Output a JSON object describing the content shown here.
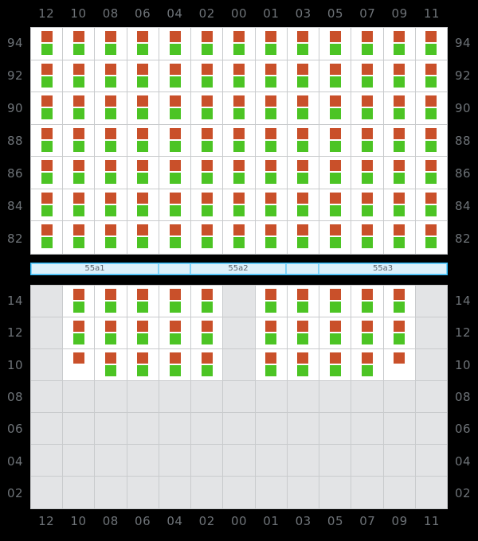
{
  "colors": {
    "background": "#000000",
    "cell_filled": "#ffffff",
    "cell_empty": "#e3e4e6",
    "grid_line": "#c9cbcd",
    "marker_red": "#c9502a",
    "marker_green": "#4cc424",
    "axis_text": "#6e7378",
    "segment_fill": "#ddf1fb",
    "segment_border": "#81d4fa",
    "segment_outer_border": "#29b6f6"
  },
  "axes": {
    "top_labels": [
      "12",
      "10",
      "08",
      "06",
      "04",
      "02",
      "00",
      "01",
      "03",
      "05",
      "07",
      "09",
      "11"
    ],
    "bottom_labels": [
      "12",
      "10",
      "08",
      "06",
      "04",
      "02",
      "00",
      "01",
      "03",
      "05",
      "07",
      "09",
      "11"
    ],
    "top_panel_row_labels": [
      "94",
      "92",
      "90",
      "88",
      "86",
      "84",
      "82"
    ],
    "bottom_panel_row_labels": [
      "14",
      "12",
      "10",
      "08",
      "06",
      "04",
      "02"
    ]
  },
  "segment_bar": {
    "segments": [
      {
        "label": "55a1",
        "flex": 161
      },
      {
        "label": "",
        "flex": 39
      },
      {
        "label": "55a2",
        "flex": 120
      },
      {
        "label": "",
        "flex": 40
      },
      {
        "label": "55a3",
        "flex": 162
      }
    ]
  },
  "chart_data": {
    "type": "heatmap",
    "title": "",
    "xlabel": "",
    "ylabel": "",
    "legend": [
      "red",
      "green"
    ],
    "panels": [
      {
        "name": "top-panel",
        "row_labels": [
          "94",
          "92",
          "90",
          "88",
          "86",
          "84",
          "82"
        ],
        "col_labels": [
          "12",
          "10",
          "08",
          "06",
          "04",
          "02",
          "00",
          "01",
          "03",
          "05",
          "07",
          "09",
          "11"
        ],
        "rows": [
          [
            "rg",
            "rg",
            "rg",
            "rg",
            "rg",
            "rg",
            "rg",
            "rg",
            "rg",
            "rg",
            "rg",
            "rg",
            "rg"
          ],
          [
            "rg",
            "rg",
            "rg",
            "rg",
            "rg",
            "rg",
            "rg",
            "rg",
            "rg",
            "rg",
            "rg",
            "rg",
            "rg"
          ],
          [
            "rg",
            "rg",
            "rg",
            "rg",
            "rg",
            "rg",
            "rg",
            "rg",
            "rg",
            "rg",
            "rg",
            "rg",
            "rg"
          ],
          [
            "rg",
            "rg",
            "rg",
            "rg",
            "rg",
            "rg",
            "rg",
            "rg",
            "rg",
            "rg",
            "rg",
            "rg",
            "rg"
          ],
          [
            "rg",
            "rg",
            "rg",
            "rg",
            "rg",
            "rg",
            "rg",
            "rg",
            "rg",
            "rg",
            "rg",
            "rg",
            "rg"
          ],
          [
            "rg",
            "rg",
            "rg",
            "rg",
            "rg",
            "rg",
            "rg",
            "rg",
            "rg",
            "rg",
            "rg",
            "rg",
            "rg"
          ],
          [
            "rg",
            "rg",
            "rg",
            "rg",
            "rg",
            "rg",
            "rg",
            "rg",
            "rg",
            "rg",
            "rg",
            "rg",
            "rg"
          ]
        ]
      },
      {
        "name": "bottom-panel",
        "row_labels": [
          "14",
          "12",
          "10",
          "08",
          "06",
          "04",
          "02"
        ],
        "col_labels": [
          "12",
          "10",
          "08",
          "06",
          "04",
          "02",
          "00",
          "01",
          "03",
          "05",
          "07",
          "09",
          "11"
        ],
        "rows": [
          [
            "x",
            "rg",
            "rg",
            "rg",
            "rg",
            "rg",
            "x",
            "rg",
            "rg",
            "rg",
            "rg",
            "rg",
            "x"
          ],
          [
            "x",
            "rg",
            "rg",
            "rg",
            "rg",
            "rg",
            "x",
            "rg",
            "rg",
            "rg",
            "rg",
            "rg",
            "x"
          ],
          [
            "x",
            "r",
            "rg",
            "rg",
            "rg",
            "rg",
            "x",
            "rg",
            "rg",
            "rg",
            "rg",
            "r",
            "x"
          ],
          [
            "x",
            "x",
            "x",
            "x",
            "x",
            "x",
            "x",
            "x",
            "x",
            "x",
            "x",
            "x",
            "x"
          ],
          [
            "x",
            "x",
            "x",
            "x",
            "x",
            "x",
            "x",
            "x",
            "x",
            "x",
            "x",
            "x",
            "x"
          ],
          [
            "x",
            "x",
            "x",
            "x",
            "x",
            "x",
            "x",
            "x",
            "x",
            "x",
            "x",
            "x",
            "x"
          ],
          [
            "x",
            "x",
            "x",
            "x",
            "x",
            "x",
            "x",
            "x",
            "x",
            "x",
            "x",
            "x",
            "x"
          ]
        ]
      }
    ],
    "cell_codes": {
      "rg": "red-and-green markers",
      "r": "red marker only",
      "g": "green marker only",
      "x": "empty cell"
    }
  }
}
